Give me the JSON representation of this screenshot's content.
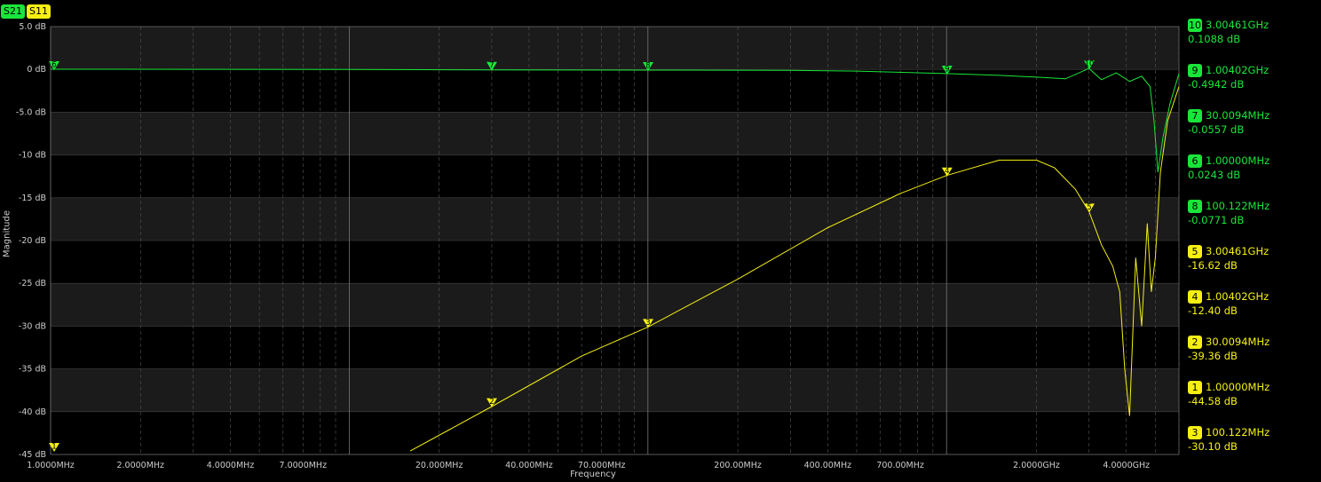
{
  "traces": {
    "s21": {
      "label": "S21",
      "color": "#19e63a"
    },
    "s11": {
      "label": "S11",
      "color": "#f5ef12"
    }
  },
  "chart_data": {
    "type": "line",
    "xlabel": "Frequency",
    "ylabel": "Magnitude",
    "xscale": "log",
    "xlim": [
      1000000,
      6000000000
    ],
    "ylim": [
      -45,
      5
    ],
    "y_ticks": [
      "5.0 dB",
      "0 dB",
      "-5.0 dB",
      "-10 dB",
      "-15 dB",
      "-20 dB",
      "-25 dB",
      "-30 dB",
      "-35 dB",
      "-40 dB",
      "-45 dB"
    ],
    "y_tick_values": [
      5,
      0,
      -5,
      -10,
      -15,
      -20,
      -25,
      -30,
      -35,
      -40,
      -45
    ],
    "x_ticks": [
      {
        "label": "1.0000MHz",
        "value": 1000000
      },
      {
        "label": "2.0000MHz",
        "value": 2000000
      },
      {
        "label": "4.0000MHz",
        "value": 4000000
      },
      {
        "label": "7.0000MHz",
        "value": 7000000
      },
      {
        "label": "20.000MHz",
        "value": 20000000
      },
      {
        "label": "40.000MHz",
        "value": 40000000
      },
      {
        "label": "70.000MHz",
        "value": 70000000
      },
      {
        "label": "200.00MHz",
        "value": 200000000
      },
      {
        "label": "400.00MHz",
        "value": 400000000
      },
      {
        "label": "700.00MHz",
        "value": 700000000
      },
      {
        "label": "2.0000GHz",
        "value": 2000000000
      },
      {
        "label": "4.0000GHz",
        "value": 4000000000
      }
    ],
    "grid": true,
    "series": [
      {
        "name": "S21",
        "color": "#19e63a",
        "x": [
          1000000,
          3000000,
          10000000,
          30000000,
          100000000,
          300000000,
          500000000,
          1000000000,
          1500000000,
          2000000000,
          2500000000,
          3000000000,
          3300000000,
          3700000000,
          4100000000,
          4500000000,
          4800000000,
          4950000000,
          5100000000,
          5300000000,
          5600000000,
          6000000000
        ],
        "y": [
          0.02,
          0.01,
          0.0,
          -0.06,
          -0.08,
          -0.1,
          -0.2,
          -0.49,
          -0.7,
          -0.9,
          -1.1,
          0.11,
          -1.2,
          -0.4,
          -1.4,
          -0.8,
          -2.0,
          -6.0,
          -12.0,
          -8.0,
          -4.0,
          -0.5
        ]
      },
      {
        "name": "S11",
        "color": "#f5ef12",
        "x": [
          16000000,
          30000000,
          60000000,
          100000000,
          200000000,
          400000000,
          700000000,
          1000000000,
          1500000000,
          2000000000,
          2300000000,
          2700000000,
          3000000000,
          3300000000,
          3600000000,
          3800000000,
          3950000000,
          4100000000,
          4300000000,
          4500000000,
          4700000000,
          4850000000,
          5000000000,
          5200000000,
          5500000000,
          6000000000
        ],
        "y": [
          -44.6,
          -39.4,
          -33.5,
          -30.1,
          -24.5,
          -18.5,
          -14.5,
          -12.4,
          -10.6,
          -10.6,
          -11.5,
          -14.0,
          -16.6,
          -20.5,
          -23.0,
          -26.0,
          -35.0,
          -40.5,
          -22.0,
          -30.0,
          -18.0,
          -26.0,
          -22.0,
          -12.0,
          -6.0,
          -2.0
        ]
      }
    ],
    "markers": [
      {
        "trace": "s21",
        "id": "10",
        "freq": "3.00461GHz",
        "val": "0.1088 dB",
        "x": 3004610000,
        "y": 0.1088
      },
      {
        "trace": "s21",
        "id": "9",
        "freq": "1.00402GHz",
        "val": "-0.4942 dB",
        "x": 1004020000,
        "y": -0.4942
      },
      {
        "trace": "s21",
        "id": "7",
        "freq": "30.0094MHz",
        "val": "-0.0557 dB",
        "x": 30009400,
        "y": -0.0557
      },
      {
        "trace": "s21",
        "id": "6",
        "freq": "1.00000MHz",
        "val": "0.0243 dB",
        "x": 1000000,
        "y": 0.0243
      },
      {
        "trace": "s21",
        "id": "8",
        "freq": "100.122MHz",
        "val": "-0.0771 dB",
        "x": 100122000,
        "y": -0.0771
      },
      {
        "trace": "s11",
        "id": "5",
        "freq": "3.00461GHz",
        "val": "-16.62 dB",
        "x": 3004610000,
        "y": -16.62
      },
      {
        "trace": "s11",
        "id": "4",
        "freq": "1.00402GHz",
        "val": "-12.40 dB",
        "x": 1004020000,
        "y": -12.4
      },
      {
        "trace": "s11",
        "id": "2",
        "freq": "30.0094MHz",
        "val": "-39.36 dB",
        "x": 30009400,
        "y": -39.36
      },
      {
        "trace": "s11",
        "id": "1",
        "freq": "1.00000MHz",
        "val": "-44.58 dB",
        "x": 1000000,
        "y": -44.58
      },
      {
        "trace": "s11",
        "id": "3",
        "freq": "100.122MHz",
        "val": "-30.10 dB",
        "x": 100122000,
        "y": -30.1
      }
    ]
  }
}
